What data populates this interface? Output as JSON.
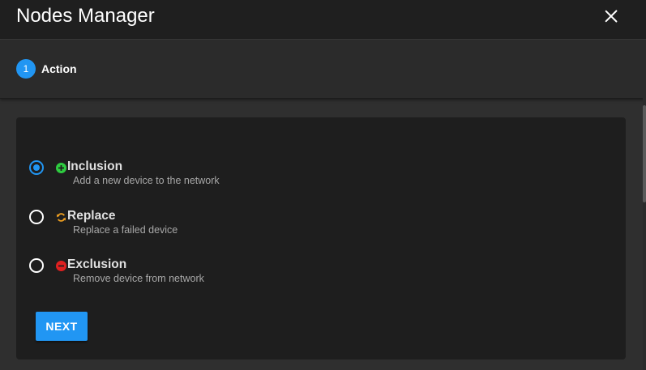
{
  "header": {
    "title": "Nodes Manager",
    "close_icon": "close-icon"
  },
  "stepper": {
    "steps": [
      {
        "number": "1",
        "label": "Action",
        "active": true
      }
    ]
  },
  "options": [
    {
      "id": "inclusion",
      "label": "Inclusion",
      "description": "Add a new device to the network",
      "icon": "plus-circle-icon",
      "icon_color": "#2ecc40",
      "selected": true
    },
    {
      "id": "replace",
      "label": "Replace",
      "description": "Replace a failed device",
      "icon": "sync-icon",
      "icon_color": "#f0a020",
      "selected": false
    },
    {
      "id": "exclusion",
      "label": "Exclusion",
      "description": "Remove device from network",
      "icon": "minus-circle-icon",
      "icon_color": "#e02020",
      "selected": false
    }
  ],
  "actions": {
    "next_label": "NEXT"
  },
  "colors": {
    "accent": "#2196f3",
    "background": "#2f2f2f",
    "card": "#1e1e1e"
  }
}
